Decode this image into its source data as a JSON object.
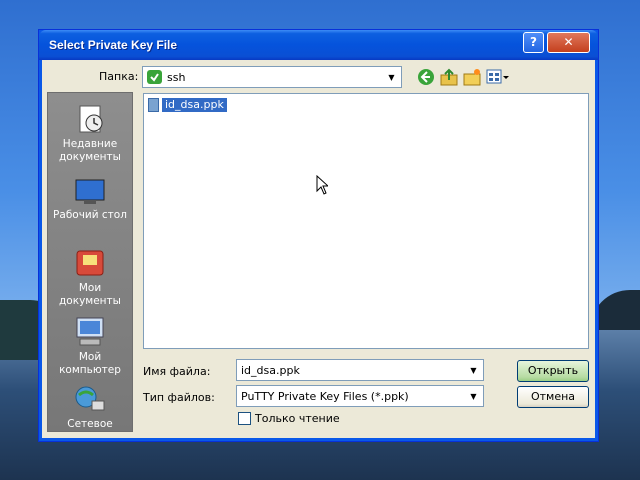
{
  "dialog": {
    "title": "Select Private Key File"
  },
  "titlebar": {
    "help_label": "?",
    "close_label": "✕"
  },
  "lookin": {
    "label": "Папка:",
    "value": "ssh"
  },
  "places": [
    {
      "label": "Недавние документы",
      "icon": "recent-documents-icon"
    },
    {
      "label": "Рабочий стол",
      "icon": "desktop-icon"
    },
    {
      "label": "Мои документы",
      "icon": "my-documents-icon"
    },
    {
      "label": "Мой компьютер",
      "icon": "my-computer-icon"
    },
    {
      "label": "Сетевое",
      "icon": "network-icon"
    }
  ],
  "files": [
    {
      "name": "id_dsa.ppk",
      "selected": true
    }
  ],
  "filename": {
    "label": "Имя файла:",
    "value": "id_dsa.ppk"
  },
  "filetype": {
    "label": "Тип файлов:",
    "value": "PuTTY Private Key Files (*.ppk)"
  },
  "readonly": {
    "label": "Только чтение",
    "checked": false
  },
  "buttons": {
    "open": "Открыть",
    "cancel": "Отмена"
  },
  "colors": {
    "titlebar": "#0553dc",
    "selection": "#316ac5",
    "dialog_bg": "#ece9d8"
  }
}
